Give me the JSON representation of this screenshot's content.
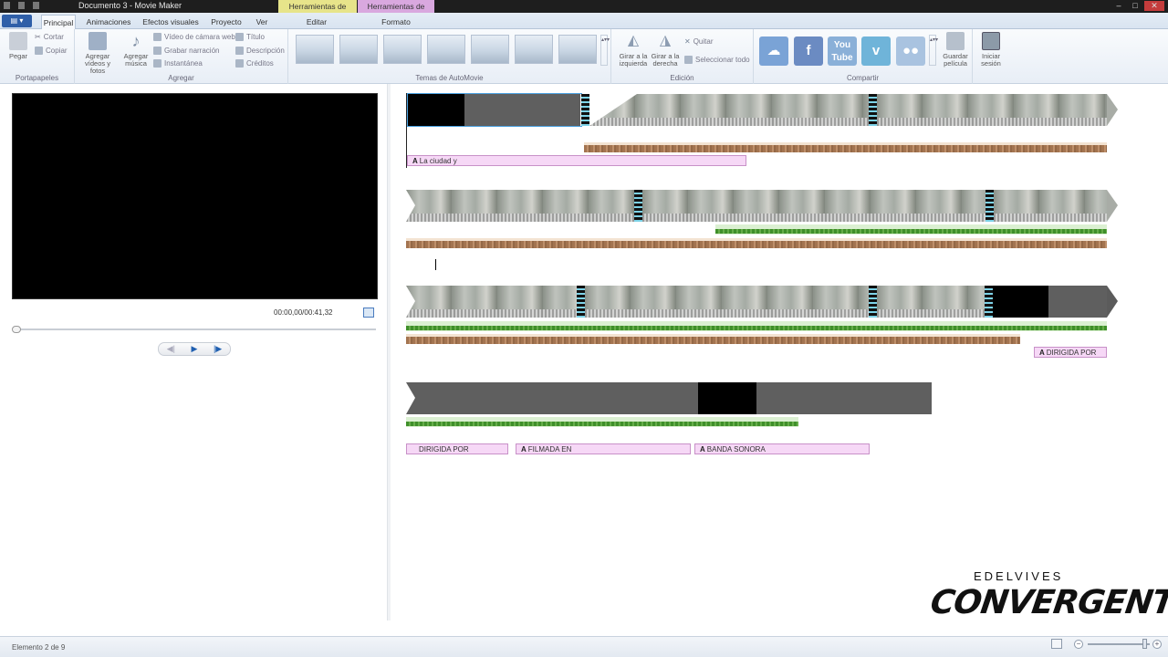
{
  "window": {
    "title": "Documento 3 - Movie Maker",
    "context_tabs": {
      "video_tools": "Herramientas de vídeo",
      "text_tools": "Herramientas de texto"
    }
  },
  "tabs": [
    "Principal",
    "Animaciones",
    "Efectos visuales",
    "Proyecto",
    "Ver",
    "Editar",
    "Formato"
  ],
  "ribbon": {
    "clipboard": {
      "label": "Portapapeles",
      "paste": "Pegar",
      "cut": "Cortar",
      "copy": "Copiar"
    },
    "add": {
      "label": "Agregar",
      "add_videos": "Agregar vídeos y fotos",
      "add_music": "Agregar música",
      "webcam_video": "Vídeo de cámara web",
      "record_narration": "Grabar narración",
      "snapshot": "Instantánea",
      "title": "Título",
      "caption": "Descripción",
      "credits": "Créditos"
    },
    "automovie": {
      "label": "Temas de AutoMovie"
    },
    "editing": {
      "label": "Edición",
      "rotate_left": "Girar a la izquierda",
      "rotate_right": "Girar a la derecha",
      "remove": "Quitar",
      "select_all": "Seleccionar todo"
    },
    "share": {
      "label": "Compartir",
      "save_movie": "Guardar película",
      "sign_in": "Iniciar sesión"
    }
  },
  "player": {
    "timecode": "00:00,00/00:41,32"
  },
  "storyboard": {
    "captions": {
      "row1": "La ciudad y",
      "row3": "DIRIGIDA POR",
      "row4a": "DIRIGIDA POR",
      "row4b": "FILMADA EN",
      "row4c": "BANDA SONORA"
    }
  },
  "status": {
    "text": "Elemento 2 de 9"
  },
  "watermark": {
    "brand_top": "EDELVIVES",
    "brand_main": "CONVERGENTE"
  },
  "colors": {
    "video_tools": "#e7e48a",
    "text_tools": "#d9a8df",
    "caption_bg": "#f6d8f6",
    "timeline": "#5b5b5b"
  }
}
